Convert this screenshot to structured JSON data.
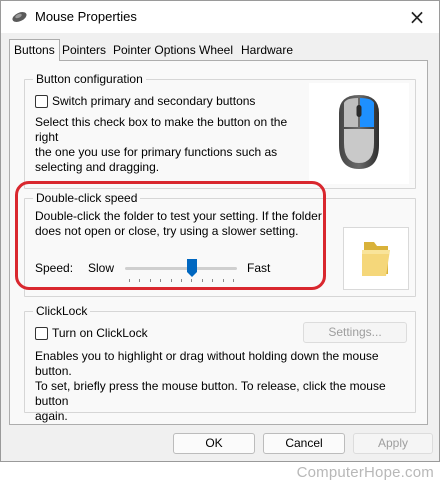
{
  "window": {
    "title": "Mouse Properties",
    "close_glyph": "×"
  },
  "tabs": [
    {
      "label": "Buttons",
      "active": true
    },
    {
      "label": "Pointers",
      "active": false
    },
    {
      "label": "Pointer Options",
      "active": false
    },
    {
      "label": "Wheel",
      "active": false
    },
    {
      "label": "Hardware",
      "active": false
    }
  ],
  "button_config": {
    "legend": "Button configuration",
    "checkbox_label": "Switch primary and secondary buttons",
    "checked": false,
    "description_lines": [
      "Select this check box to make the button on the right",
      "the one you use for primary functions such as",
      "selecting and dragging."
    ],
    "image_icon": "mouse-icon"
  },
  "double_click": {
    "legend": "Double-click speed",
    "description_lines": [
      "Double-click the folder to test your setting. If the folder",
      "does not open or close, try using a slower setting."
    ],
    "speed_label": "Speed:",
    "slow_label": "Slow",
    "fast_label": "Fast",
    "slider_value": 0.6,
    "folder_icon": "folder-icon"
  },
  "clicklock": {
    "legend": "ClickLock",
    "checkbox_label": "Turn on ClickLock",
    "checked": false,
    "settings_label": "Settings...",
    "description_lines": [
      "Enables you to highlight or drag without holding down the mouse button.",
      "To set, briefly press the mouse button. To release, click the mouse button",
      "again."
    ]
  },
  "buttons": {
    "ok": "OK",
    "cancel": "Cancel",
    "apply": "Apply"
  },
  "colors": {
    "highlight": "#d9272e",
    "slider_thumb": "#0067c0",
    "mouse_accent": "#1e90ff"
  },
  "watermark": "ComputerHope.com"
}
